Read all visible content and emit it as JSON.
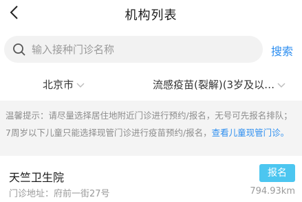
{
  "header": {
    "title": "机构列表",
    "back_icon": "chevron-left-icon"
  },
  "search": {
    "placeholder": "输入接种门诊名称",
    "value": "",
    "button_label": "搜索",
    "icon": "search-icon"
  },
  "filters": {
    "city": "北京市",
    "vaccine": "流感疫苗(裂解)(3岁及以…"
  },
  "notice": {
    "text": "温馨提示：请尽量选择居住地附近门诊进行预约/报名，无号可先报名排队；7周岁以下儿童只能选择现管门诊进行疫苗预约/报名，",
    "link_text": "查看儿童现管门诊。"
  },
  "clinics": [
    {
      "name": "天竺卫生院",
      "address": "门诊地址：府前一街27号",
      "distance": "794.93km",
      "button_label": "报名"
    }
  ],
  "colors": {
    "accent": "#2c8ef0",
    "register_button": "#4cc6f0",
    "notice_background": "#f4f4f4",
    "search_background": "#f2f2f2"
  }
}
